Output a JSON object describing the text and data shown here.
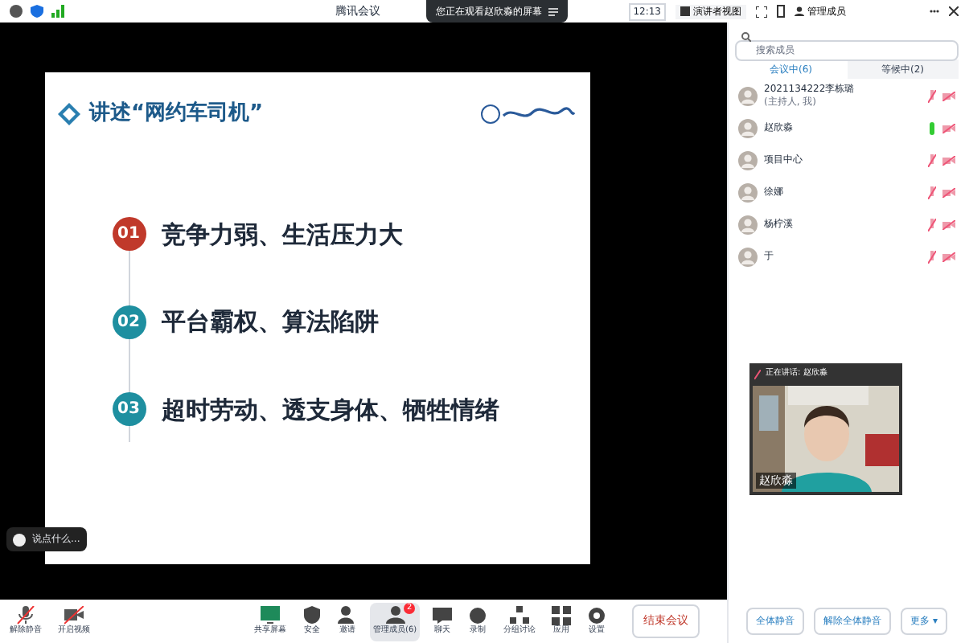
{
  "window": {
    "title": "腾讯会议",
    "time": "12:13",
    "view_button": "演讲者视图",
    "manage_button": "管理成员"
  },
  "sharing_banner": "您正在观看赵欣淼的屏幕",
  "slide": {
    "title": "讲述“网约车司机”",
    "points": [
      {
        "number": "01",
        "text": "竞争力弱、生活压力大",
        "color": "#c0392b"
      },
      {
        "number": "02",
        "text": "平台霸权、算法陷阱",
        "color": "#1e8fa0"
      },
      {
        "number": "03",
        "text": "超时劳动、透支身体、牺牲情绪",
        "color": "#1e8fa0"
      }
    ]
  },
  "chat_hint": "说点什么...",
  "members": {
    "search": {
      "placeholder": "搜索成员"
    },
    "tabs": [
      {
        "label": "会议中(6)",
        "selected": true
      },
      {
        "label": "等候中(2)",
        "selected": false
      }
    ],
    "list": [
      {
        "name": "2021134222李栋璐",
        "role": "(主持人, 我)",
        "mic_on": false
      },
      {
        "name": "赵欣淼",
        "mic_on": true
      },
      {
        "name": "项目中心",
        "mic_on": false
      },
      {
        "name": "徐娜",
        "mic_on": false
      },
      {
        "name": "杨柠溪",
        "mic_on": false
      },
      {
        "name": "于",
        "mic_on": false
      }
    ],
    "buttons": [
      "全体静音",
      "解除全体静音",
      "更多 ▾"
    ]
  },
  "speaker": {
    "label": "正在讲话: 赵欣淼",
    "name": "赵欣淼"
  },
  "toolbar": [
    {
      "label": "解除静音",
      "kind": "mic",
      "selected": false
    },
    {
      "label": "开启视频",
      "kind": "video",
      "selected": false
    },
    {
      "label": "共享屏幕",
      "kind": "share",
      "selected": false
    },
    {
      "label": "安全",
      "kind": "shield",
      "selected": false
    },
    {
      "label": "邀请",
      "kind": "invite",
      "selected": false
    },
    {
      "label": "管理成员(6)",
      "kind": "members",
      "badge": "2",
      "selected": true
    },
    {
      "label": "聊天",
      "kind": "chat",
      "selected": false
    },
    {
      "label": "录制",
      "kind": "record",
      "selected": false
    },
    {
      "label": "分组讨论",
      "kind": "groups",
      "selected": false
    },
    {
      "label": "应用",
      "kind": "apps",
      "selected": false
    },
    {
      "label": "设置",
      "kind": "gear",
      "selected": false
    }
  ],
  "end_button": "结束会议"
}
